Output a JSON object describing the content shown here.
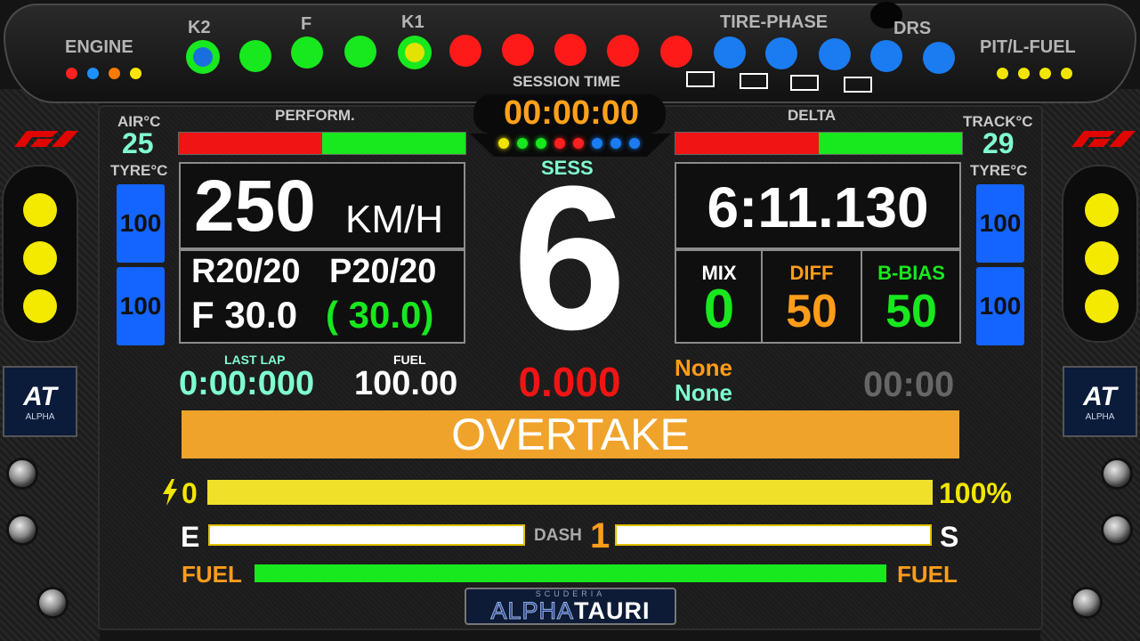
{
  "top": {
    "engine_label": "ENGINE",
    "k2_label": "K2",
    "f_label": "F",
    "k1_label": "K1",
    "tire_phase_label": "TIRE-PHASE",
    "drs_label": "DRS",
    "pit_fuel_label": "PIT/L-FUEL",
    "session_time_label": "SESSION TIME",
    "session_time": "00:00:00",
    "engine_dot_colors": [
      "#ff2020",
      "#1e90ff",
      "#ff7a00",
      "#ffe600"
    ],
    "shift_led_colors": [
      "#18e81e",
      "#18e81e",
      "#18e81e",
      "#18e81e",
      "#ff1a1a",
      "#ff1a1a",
      "#ff1a1a",
      "#ff1a1a",
      "#ff1a1a",
      "#1a7cf0",
      "#1a7cf0",
      "#1a7cf0",
      "#1a7cf0",
      "#1a7cf0"
    ],
    "mini_led_colors": [
      "#f0e400",
      "#18e81e",
      "#18e81e",
      "#ff2020",
      "#ff2020",
      "#1a7cf0",
      "#1a7cf0",
      "#1a7cf0"
    ]
  },
  "left": {
    "air_label": "AIR°C",
    "air_value": "25",
    "tyre_label": "TYRE°C",
    "tyre_values": [
      "100",
      "100"
    ],
    "perform_label": "PERFORM.",
    "perform_ratio": 0.5
  },
  "right": {
    "track_label": "TRACK°C",
    "track_value": "29",
    "tyre_label": "TYRE°C",
    "tyre_values": [
      "100",
      "100"
    ],
    "delta_label": "DELTA",
    "delta_ratio": 0.5
  },
  "speed": {
    "value": "250",
    "unit": "KM/H"
  },
  "pressure": {
    "r": "R20/20",
    "p": "P20/20",
    "f": "F 30.0",
    "f_target": "( 30.0)"
  },
  "gear": {
    "sess_label": "SESS",
    "value": "6",
    "delta_time": "0.000"
  },
  "laptime": {
    "value": "6:11.130"
  },
  "settings": {
    "mix_label": "MIX",
    "mix_value": "0",
    "diff_label": "DIFF",
    "diff_value": "50",
    "bbias_label": "B-BIAS",
    "bbias_value": "50"
  },
  "info": {
    "last_lap_label": "LAST LAP",
    "last_lap": "0:00:000",
    "fuel_label": "FUEL",
    "fuel": "100.00",
    "none1": "None",
    "none2": "None",
    "timer": "00:00"
  },
  "banner": {
    "text": "OVERTAKE"
  },
  "ers": {
    "min": "0",
    "max": "100%",
    "level": 1.0
  },
  "dash": {
    "e_label": "E",
    "dash_label": "DASH",
    "dash_value": "1",
    "s_label": "S"
  },
  "fuel_bar": {
    "left_label": "FUEL",
    "right_label": "FUEL",
    "level": 1.0
  },
  "logo": {
    "small": "SCUDERIA",
    "alpha": "ALPHA",
    "tauri": "TAURI"
  }
}
